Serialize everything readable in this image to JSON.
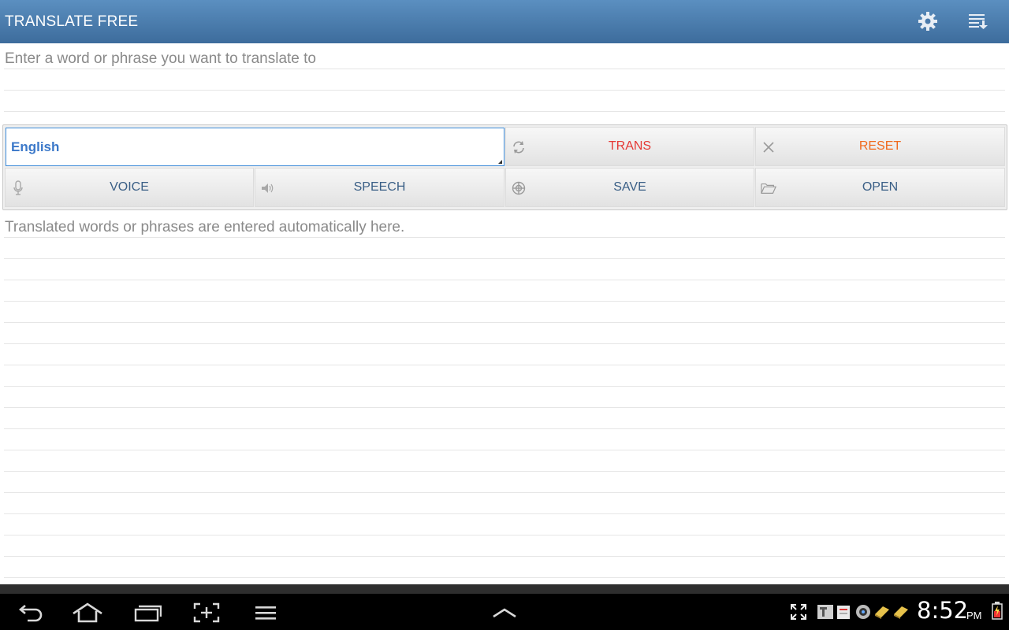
{
  "app": {
    "title": "TRANSLATE FREE"
  },
  "actionbar": {
    "icons": [
      "gear-icon",
      "sort-download-icon"
    ]
  },
  "input": {
    "placeholder": "Enter a word or phrase you want to translate to"
  },
  "language": {
    "selected": "English"
  },
  "buttons": {
    "trans": "TRANS",
    "reset": "RESET",
    "voice": "VOICE",
    "speech": "SPEECH",
    "save": "SAVE",
    "open": "OPEN"
  },
  "output": {
    "placeholder": "Translated words or phrases are entered automatically here."
  },
  "statusbar": {
    "time": "8:52",
    "ampm": "PM"
  },
  "colors": {
    "titlebar": "#4a7aab",
    "trans": "#e53935",
    "reset": "#f06a1e",
    "button_text": "#3a5f86",
    "language_text": "#3b78c9"
  }
}
